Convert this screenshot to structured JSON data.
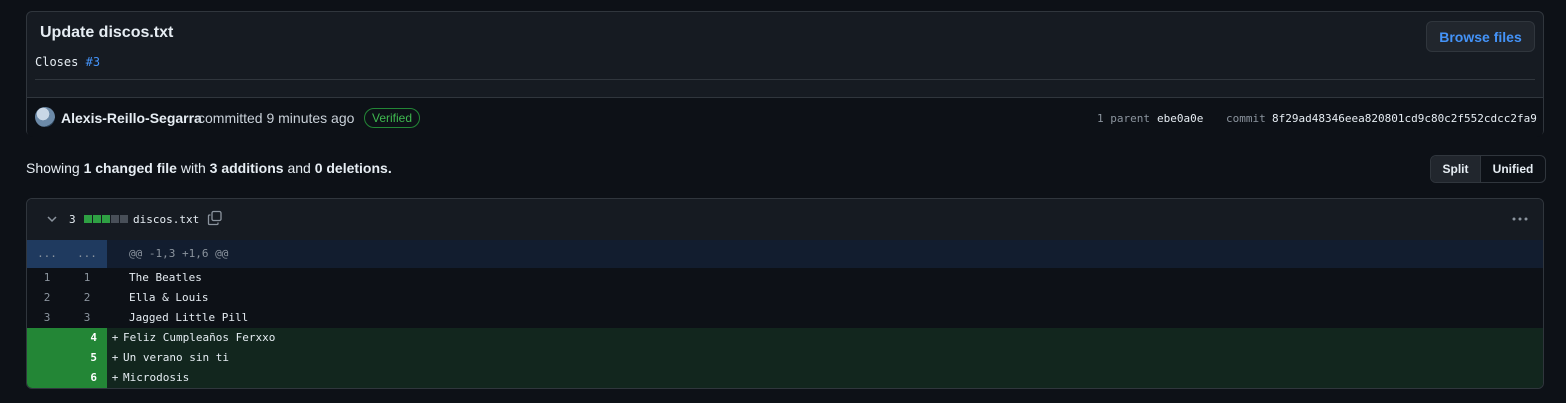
{
  "commit": {
    "title": "Update discos.txt",
    "description_prefix": "Closes",
    "issue_ref": "#3",
    "browse_button": "Browse files",
    "author": "Alexis-Reillo-Segarra",
    "committed_text": "committed 9 minutes ago",
    "verified_badge": "Verified",
    "parent_label": "1 parent",
    "parent_sha": "ebe0a0e",
    "commit_label": "commit",
    "commit_sha": "8f29ad48346eea820801cd9c80c2f552cdcc2fa9"
  },
  "summary": {
    "showing": "Showing",
    "changed_files": "1 changed file",
    "with": "with",
    "additions": "3 additions",
    "and": "and",
    "deletions": "0 deletions",
    "period": ".",
    "view_split": "Split",
    "view_unified": "Unified"
  },
  "file": {
    "change_count": "3",
    "name": "discos.txt",
    "diffstat_colors": [
      "#2ea043",
      "#2ea043",
      "#2ea043",
      "#484f58",
      "#484f58"
    ],
    "hunk": {
      "left_num": "...",
      "right_num": "...",
      "header": "@@ -1,3 +1,6 @@"
    },
    "context_lines": [
      {
        "old": "1",
        "new": "1",
        "text": "The Beatles"
      },
      {
        "old": "2",
        "new": "2",
        "text": "Ella & Louis"
      },
      {
        "old": "3",
        "new": "3",
        "text": "Jagged Little Pill"
      }
    ],
    "added_lines": [
      {
        "new": "4",
        "sign": "+",
        "text": "Feliz Cumpleaños Ferxxo"
      },
      {
        "new": "5",
        "sign": "+",
        "text": "Un verano sin ti"
      },
      {
        "new": "6",
        "sign": "+",
        "text": "Microdosis"
      }
    ]
  },
  "colors": {
    "background": "#0d1117",
    "accent_link": "#4493f8",
    "addition_bg": "#12261e",
    "addition_num_bg": "#238636",
    "hunk_bg": "#121d2f"
  }
}
